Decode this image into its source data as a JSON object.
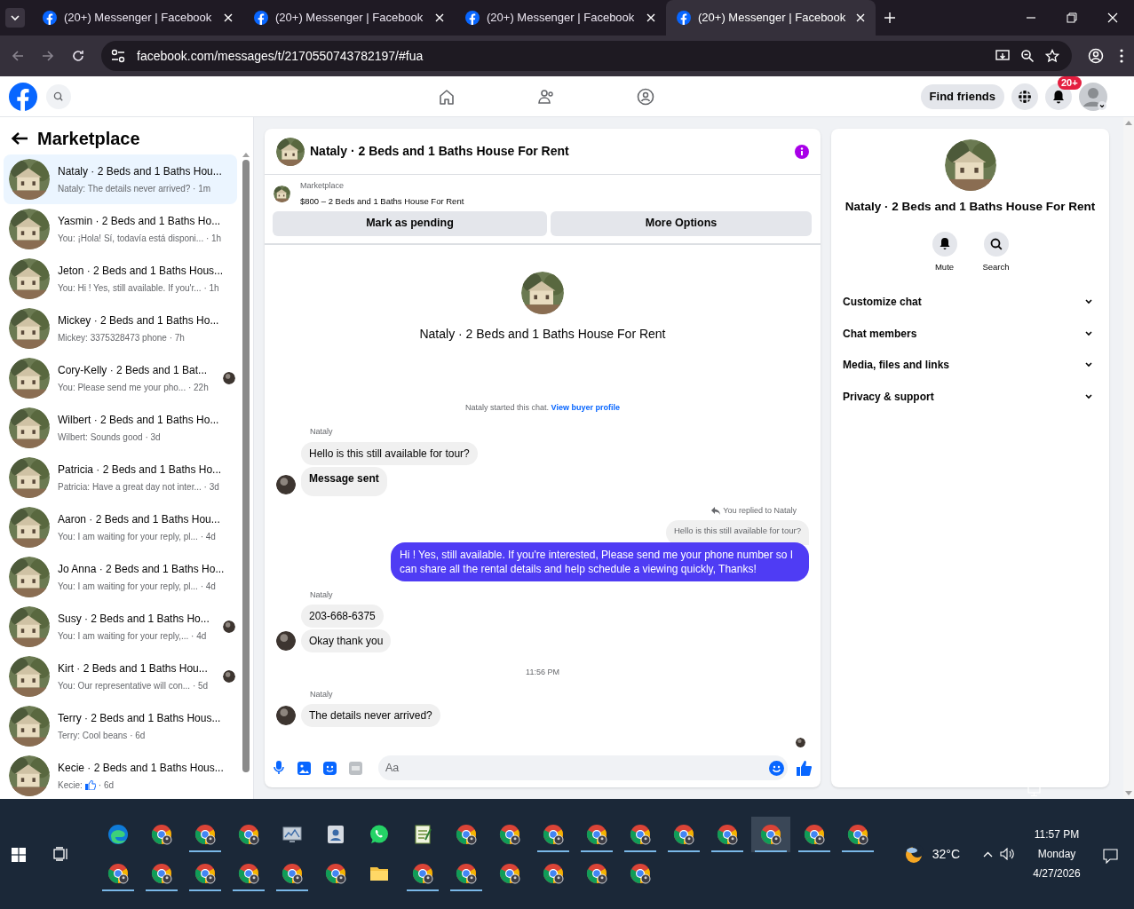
{
  "browser": {
    "tabs": [
      {
        "title": "(20+) Messenger | Facebook",
        "selected": false
      },
      {
        "title": "(20+) Messenger | Facebook",
        "selected": false
      },
      {
        "title": "(20+) Messenger | Facebook",
        "selected": false
      },
      {
        "title": "(20+) Messenger | Facebook",
        "selected": true
      }
    ],
    "url": "facebook.com/messages/t/2170550743782197/#fua"
  },
  "header": {
    "find_friends": "Find friends",
    "notification_badge": "20+"
  },
  "sidebar": {
    "title": "Marketplace",
    "conversations": [
      {
        "title": "Nataly · 2 Beds and 1 Baths Hou...",
        "preview": "Nataly: The details never arrived? · 1m",
        "selected": true,
        "seen": false
      },
      {
        "title": "Yasmin · 2 Beds and 1 Baths Ho...",
        "preview": "You: ¡Hola! Sí, todavía está disponi... · 1h",
        "selected": false,
        "seen": false
      },
      {
        "title": "Jeton · 2 Beds and 1 Baths Hous...",
        "preview": "You: Hi ! Yes, still available. If you'r... · 1h",
        "selected": false,
        "seen": false
      },
      {
        "title": "Mickey · 2 Beds and 1 Baths Ho...",
        "preview": "Mickey: 3375328473 phone · 7h",
        "selected": false,
        "seen": false
      },
      {
        "title": "Cory-Kelly · 2 Beds and 1 Bat...",
        "preview": "You: Please send me your pho... · 22h",
        "selected": false,
        "seen": true
      },
      {
        "title": "Wilbert · 2 Beds and 1 Baths Ho...",
        "preview": "Wilbert: Sounds good · 3d",
        "selected": false,
        "seen": false
      },
      {
        "title": "Patricia · 2 Beds and 1 Baths Ho...",
        "preview": "Patricia: Have a great day not inter... · 3d",
        "selected": false,
        "seen": false
      },
      {
        "title": "Aaron · 2 Beds and 1 Baths Hou...",
        "preview": "You: I am waiting for your reply, pl... · 4d",
        "selected": false,
        "seen": false
      },
      {
        "title": "Jo Anna · 2 Beds and 1 Baths Ho...",
        "preview": "You: I am waiting for your reply, pl... · 4d",
        "selected": false,
        "seen": false
      },
      {
        "title": "Susy · 2 Beds and 1 Baths Ho...",
        "preview": "You: I am waiting for your reply,... · 4d",
        "selected": false,
        "seen": true
      },
      {
        "title": "Kirt · 2 Beds and 1 Baths Hou...",
        "preview": "You: Our representative will con... · 5d",
        "selected": false,
        "seen": true
      },
      {
        "title": "Terry · 2 Beds and 1 Baths Hous...",
        "preview": "Terry: Cool beans · 6d",
        "selected": false,
        "seen": false
      },
      {
        "title": "Kecie · 2 Beds and 1 Baths Hous...",
        "preview": "Kecie:",
        "like": true,
        "time": "· 6d",
        "selected": false,
        "seen": false
      }
    ]
  },
  "chat": {
    "title": "Nataly · 2 Beds and 1 Baths House For Rent",
    "listing": {
      "label": "Marketplace",
      "text": "$800 – 2 Beds and 1 Baths House For Rent"
    },
    "buttons": [
      "Mark as pending",
      "More Options"
    ],
    "intro_title": "Nataly · 2 Beds and 1 Baths House For Rent",
    "started": "Nataly started this chat.",
    "profile_link": "View buyer profile",
    "messages": [
      {
        "kind": "sender",
        "text": "Nataly"
      },
      {
        "kind": "incoming",
        "text": "Hello is this still available for tour?",
        "avatar": false,
        "bold": false
      },
      {
        "kind": "incoming",
        "text": "Message sent",
        "avatar": true,
        "bold": true
      },
      {
        "kind": "reply-note",
        "text": "You replied to Nataly"
      },
      {
        "kind": "quoted",
        "text": "Hello is this still available for tour?"
      },
      {
        "kind": "outgoing",
        "text": "Hi ! Yes, still available. If you're interested, Please send me your phone number so I can share all the rental details and help schedule a viewing quickly, Thanks!"
      },
      {
        "kind": "sender",
        "text": "Nataly"
      },
      {
        "kind": "incoming",
        "text": "203-668-6375",
        "avatar": false,
        "bold": false
      },
      {
        "kind": "incoming",
        "text": "Okay thank you",
        "avatar": true,
        "bold": false
      },
      {
        "kind": "time",
        "text": "11:56 PM"
      },
      {
        "kind": "sender",
        "text": "Nataly"
      },
      {
        "kind": "incoming",
        "text": "The details never arrived?",
        "avatar": true,
        "bold": false
      },
      {
        "kind": "seen"
      }
    ],
    "composer": {
      "placeholder": "Aa"
    }
  },
  "details": {
    "title": "Nataly · 2 Beds and 1 Baths House For Rent",
    "actions": [
      "Mute",
      "Search"
    ],
    "sections": [
      "Customize chat",
      "Chat members",
      "Media, files and links",
      "Privacy & support"
    ]
  },
  "taskbar": {
    "row_1": [
      {
        "kind": "edge",
        "open": false,
        "selected": false
      },
      {
        "kind": "chrome",
        "open": false,
        "selected": false
      },
      {
        "kind": "chrome",
        "open": true,
        "selected": false
      },
      {
        "kind": "chrome",
        "open": false,
        "selected": false
      },
      {
        "kind": "monitor",
        "open": false,
        "selected": false
      },
      {
        "kind": "contacts",
        "open": false,
        "selected": false
      },
      {
        "kind": "whatsapp",
        "open": false,
        "selected": false
      },
      {
        "kind": "notepad",
        "open": false,
        "selected": false
      },
      {
        "kind": "chrome",
        "open": false,
        "selected": false
      },
      {
        "kind": "chrome",
        "open": false,
        "selected": false
      },
      {
        "kind": "chrome",
        "open": true,
        "selected": false
      },
      {
        "kind": "chrome",
        "open": true,
        "selected": false
      },
      {
        "kind": "chrome",
        "open": true,
        "selected": false
      },
      {
        "kind": "chrome",
        "open": true,
        "selected": false
      },
      {
        "kind": "chrome",
        "open": true,
        "selected": false
      },
      {
        "kind": "chrome",
        "open": true,
        "selected": true
      },
      {
        "kind": "chrome",
        "open": true,
        "selected": false
      },
      {
        "kind": "chrome",
        "open": true,
        "selected": false
      }
    ],
    "row_2": [
      {
        "kind": "chrome",
        "open": true,
        "selected": false
      },
      {
        "kind": "chrome",
        "open": true,
        "selected": false
      },
      {
        "kind": "chrome",
        "open": true,
        "selected": false
      },
      {
        "kind": "chrome",
        "open": true,
        "selected": false
      },
      {
        "kind": "chrome",
        "open": true,
        "selected": false
      },
      {
        "kind": "chrome",
        "open": false,
        "selected": false
      },
      {
        "kind": "folder",
        "open": false,
        "selected": false
      },
      {
        "kind": "chrome",
        "open": true,
        "selected": false
      },
      {
        "kind": "chrome",
        "open": true,
        "selected": false
      },
      {
        "kind": "chrome",
        "open": false,
        "selected": false
      },
      {
        "kind": "chrome",
        "open": false,
        "selected": false
      },
      {
        "kind": "chrome",
        "open": false,
        "selected": false
      },
      {
        "kind": "chrome",
        "open": false,
        "selected": false
      }
    ],
    "weather": "32°C",
    "time": "11:57 PM",
    "day": "Monday",
    "date": "4/27/2026"
  }
}
